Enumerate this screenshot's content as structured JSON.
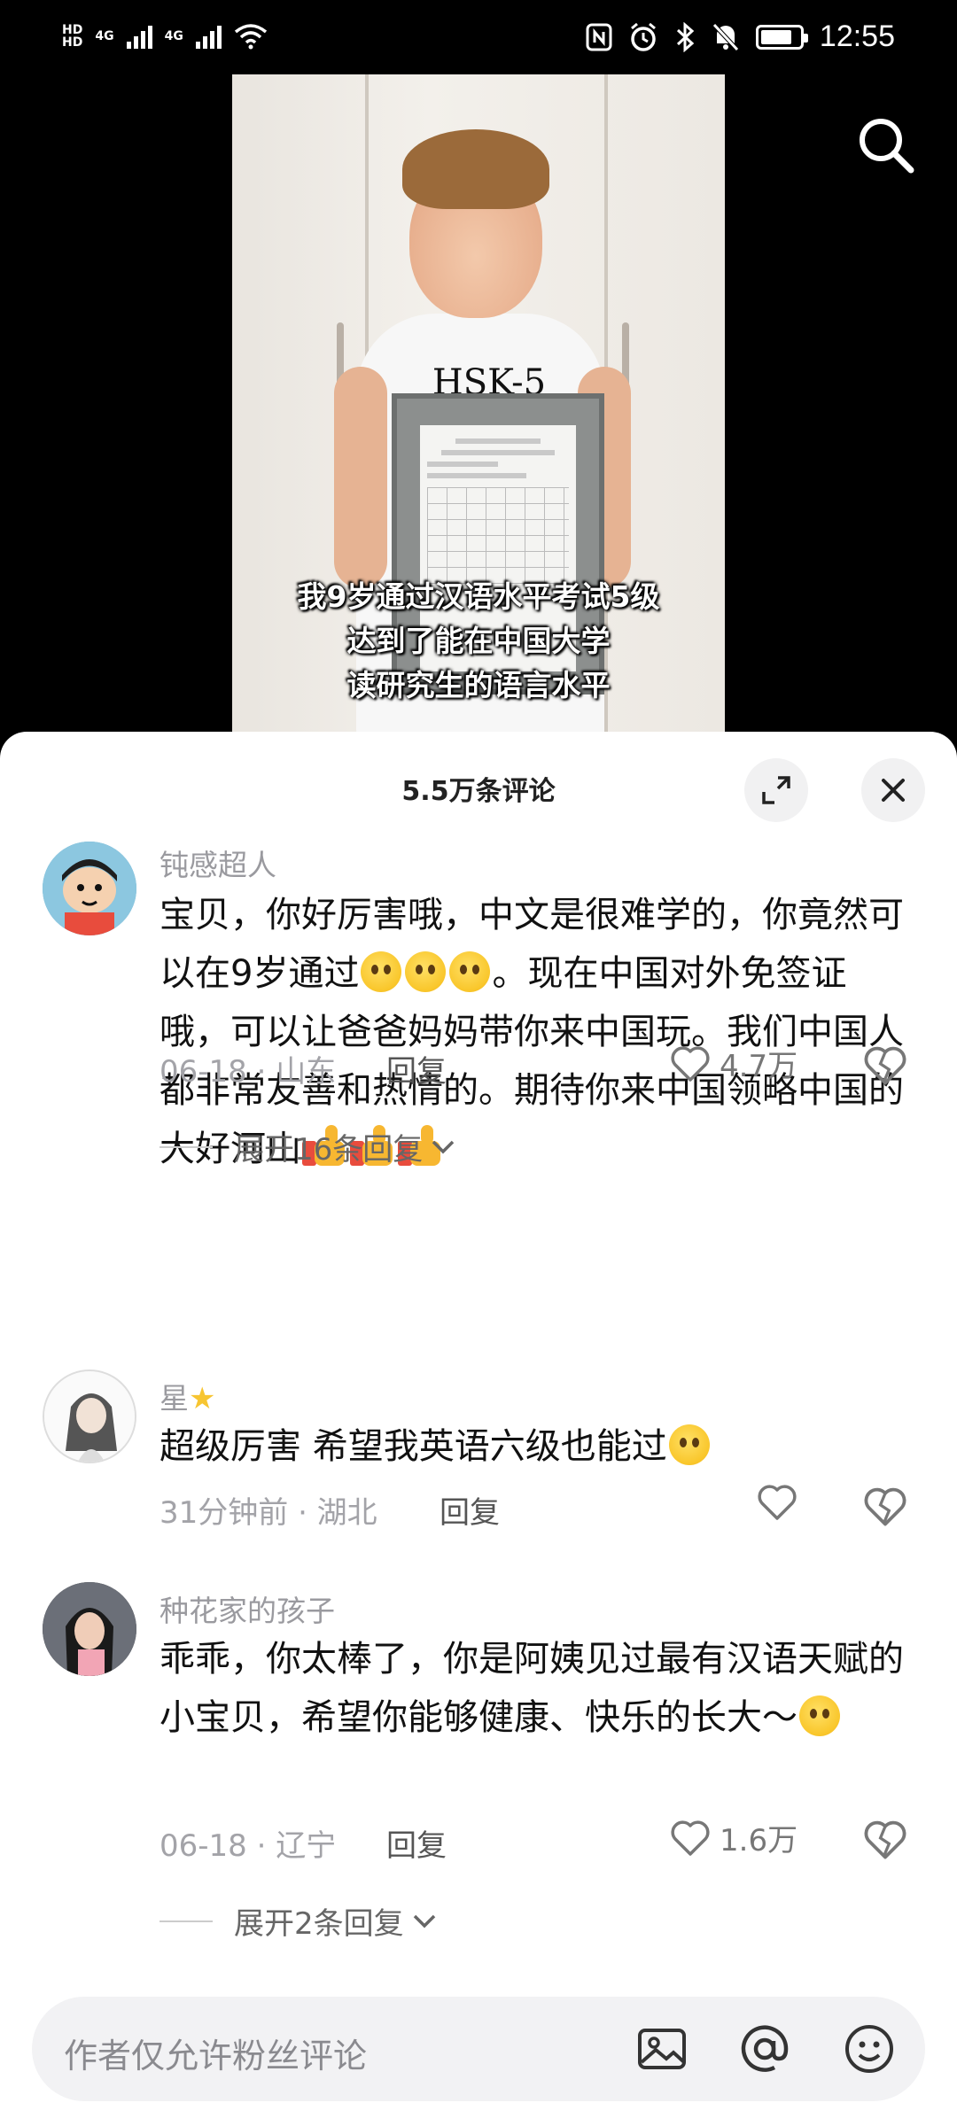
{
  "status_bar": {
    "time": "12:55",
    "hd1": "HD",
    "hd2": "HD",
    "net1": "4G",
    "net2": "4G"
  },
  "video": {
    "shirt_text": "HSK-5",
    "caption_lines": [
      "我9岁通过汉语水平考试5级",
      "达到了能在中国大学",
      "读研究生的语言水平"
    ]
  },
  "comments_panel": {
    "title": "5.5万条评论",
    "comments": [
      {
        "user": "钝感超人",
        "text_part1": "宝贝，你好厉害哦，中文是很难学的，你竟然可以在9岁通过",
        "text_part2": "。现在中国对外免签证哦，可以让爸爸妈妈带你来中国玩。我们中国人都非常友善和热情的。期待你来中国领略中国的大好河山",
        "date": "06-18 · 山东",
        "reply_label": "回复",
        "likes": "4.7万",
        "expand_label": "展开16条回复"
      },
      {
        "user": "星",
        "text": "超级厉害 希望我英语六级也能过",
        "date": "31分钟前 · 湖北",
        "reply_label": "回复",
        "likes": ""
      },
      {
        "user": "种花家的孩子",
        "text": "乖乖，你太棒了，你是阿姨见过最有汉语天赋的小宝贝，希望你能够健康、快乐的长大～",
        "date": "06-18 · 辽宁",
        "reply_label": "回复",
        "likes": "1.6万",
        "expand_label": "展开2条回复"
      }
    ]
  },
  "input_bar": {
    "placeholder": "作者仅允许粉丝评论"
  },
  "icons": [
    "search-icon",
    "expand-icon",
    "close-icon",
    "heart-icon",
    "broken-heart-icon",
    "chevron-down-icon",
    "image-icon",
    "at-icon",
    "emoji-icon",
    "star-emoji",
    "teary-emoji",
    "thumbs-up-emoji",
    "laughing-emoji",
    "grin-emoji"
  ]
}
